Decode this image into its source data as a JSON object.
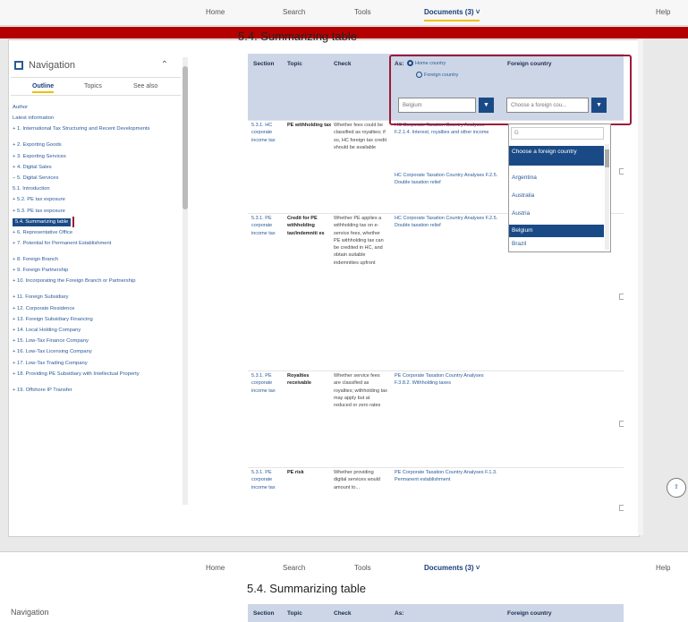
{
  "topnav": {
    "home": "Home",
    "search": "Search",
    "tools": "Tools",
    "documents": "Documents (3) ˅",
    "help": "Help"
  },
  "page_title": "5.4. Summarizing table",
  "navigation": {
    "title": "Navigation",
    "tabs": [
      "Outline",
      "Topics",
      "See also"
    ],
    "items": [
      "Author",
      "Latest information",
      "+ 1. International Tax Structuring and Recent Developments",
      "+ 2. Exporting Goods",
      "+ 3. Exporting Services",
      "+ 4. Digital Sales",
      "− 5. Digital Services",
      "5.1. Introduction",
      "+ 5.2. PE tax exposure",
      "+ 5.3. PE tax exposure",
      "5.4. Summarizing table",
      "+ 6. Representative Office",
      "+ 7. Potential for Permanent Establishment",
      "+ 8. Foreign Branch",
      "+ 9. Foreign Partnership",
      "+ 10. Incorporating the Foreign Branch or Partnership",
      "+ 11. Foreign Subsidiary",
      "+ 12. Corporate Residence",
      "+ 13. Foreign Subsidiary Financing",
      "+ 14. Local Holding Company",
      "+ 15. Low-Tax Finance Company",
      "+ 16. Low-Tax Licensing Company",
      "+ 17. Low-Tax Trading Company",
      "+ 18. Providing PE Subsidiary with Intellectual Property",
      "+ 19. Offshore IP Transfer"
    ],
    "selected_index": 10
  },
  "table": {
    "headers": {
      "section": "Section",
      "topic": "Topic",
      "check": "Check",
      "as": "As:",
      "foreign": "Foreign country"
    },
    "radio_home": "Home country",
    "radio_foreign": "Foreign country",
    "home_select_value": "Belgium",
    "foreign_select_placeholder": "Choose a foreign cou...",
    "rows": [
      {
        "section": "5.3.1. HC corporate income tax",
        "topic": "PE withholding tax",
        "check": "Whether fees could be classified as royalties; if so, HC foreign tax credit should be available",
        "home": "HC Corporate Taxation Country Analyses F.2.1.4. Interest, royalties and other income",
        "home2": "HC Corporate Taxation Country Analyses F.2.5. Double taxation relief"
      },
      {
        "section": "5.3.1. PE corporate income tax",
        "topic": "Credit for PE withholding tax/indemniti es",
        "check": "Whether PE applies a withholding tax on e-service fees, whether PE withholding tax can be credited in HC, and obtain suitable indemnities upfront",
        "home": "HC Corporate Taxation Country Analyses F.2.5. Double taxation relief",
        "home2": ""
      },
      {
        "section": "5.3.1. PE corporate income tax",
        "topic": "Royalties receivable",
        "check": "Whether service fees are classified as royalties; withholding tax may apply but at reduced or zero rates",
        "home": "PE Corporate Taxation Country Analyses F.3.8.2. Withholding taxes",
        "home2": ""
      },
      {
        "section": "5.3.1. PE corporate income tax",
        "topic": "PE risk",
        "check": "Whether providing digital services would amount to...",
        "home": "PE Corporate Taxation Country Analyses F.1.3. Permanent establishment",
        "home2": ""
      }
    ]
  },
  "dropdown": {
    "search_value": "G",
    "options": [
      "Choose a foreign country",
      "Argentina",
      "Australia",
      "Austria",
      "Belgium",
      "Brazil"
    ],
    "highlighted": [
      "Choose a foreign country",
      "Belgium"
    ]
  },
  "fab_label": "⇧",
  "bottom_copy": {
    "home": "Home",
    "search": "Search",
    "tools": "Tools",
    "documents": "Documents (3) ˅",
    "help": "Help",
    "title": "5.4. Summarizing table",
    "nav_label": "Navigation",
    "section": "Section",
    "topic": "Topic",
    "check": "Check",
    "as": "As:",
    "foreign": "Foreign country"
  },
  "colors": {
    "accent": "#1a4a86",
    "highlight": "#9b1b3b",
    "banner": "#b40000",
    "tab_underline": "#f0c000"
  }
}
